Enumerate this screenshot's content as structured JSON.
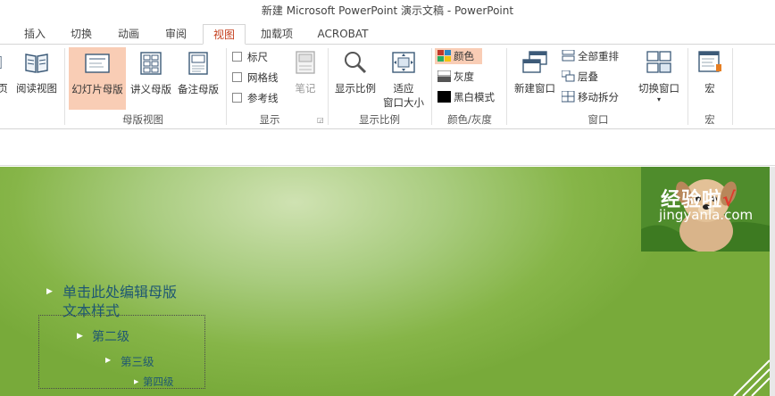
{
  "window": {
    "title": "新建 Microsoft PowerPoint 演示文稿 - PowerPoint"
  },
  "tabs": [
    "插入",
    "切换",
    "动画",
    "审阅",
    "视图",
    "加载项",
    "ACROBAT"
  ],
  "active_tab": "视图",
  "ribbon": {
    "presentation_views": {
      "partial_label": "页",
      "reading_view": "阅读视图"
    },
    "master_views": {
      "slide_master": "幻灯片母版",
      "handout_master": "讲义母版",
      "notes_master": "备注母版",
      "group": "母版视图"
    },
    "show": {
      "ruler": "标尺",
      "gridlines": "网格线",
      "guides": "参考线",
      "notes": "笔记",
      "group": "显示"
    },
    "zoom": {
      "zoom": "显示比例",
      "fit_line1": "适应",
      "fit_line2": "窗口大小",
      "group": "显示比例"
    },
    "color": {
      "color": "颜色",
      "grayscale": "灰度",
      "bw": "黑白模式",
      "group": "颜色/灰度"
    },
    "window": {
      "new_window": "新建窗口",
      "arrange_all": "全部重排",
      "cascade": "层叠",
      "move_split": "移动拆分",
      "switch_windows": "切换窗口",
      "group": "窗口"
    },
    "macros": {
      "macros": "宏",
      "group": "宏"
    }
  },
  "slide": {
    "level1_line1": "单击此处编辑母版",
    "level1_line2": "文本样式",
    "level2": "第二级",
    "level3": "第三级",
    "level4": "第四级"
  },
  "watermark": {
    "text": "经验啦",
    "check": "√",
    "url": "jingyanla.com"
  },
  "colors": {
    "accent": "#c43e1c",
    "highlight": "#f9cdb5",
    "slide_green": "#86b548",
    "text_blue": "#1f5872"
  }
}
